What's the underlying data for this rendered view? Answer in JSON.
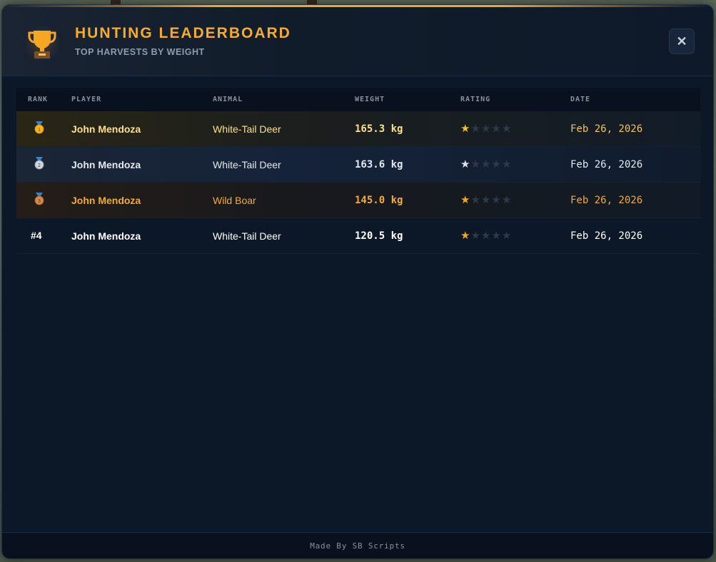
{
  "header": {
    "title": "HUNTING LEADERBOARD",
    "subtitle": "TOP HARVESTS BY WEIGHT",
    "close_label": "✕",
    "icon": "trophy-icon"
  },
  "table": {
    "columns": [
      "RANK",
      "PLAYER",
      "ANIMAL",
      "WEIGHT",
      "RATING",
      "DATE"
    ],
    "rows": [
      {
        "rank": "",
        "medal": "gold-medal-icon",
        "player": "John Mendoza",
        "animal": "White-Tail Deer",
        "weight": "165.3 kg",
        "rating": 1,
        "date": "Feb 26, 2026"
      },
      {
        "rank": "",
        "medal": "silver-medal-icon",
        "player": "John Mendoza",
        "animal": "White-Tail Deer",
        "weight": "163.6 kg",
        "rating": 1,
        "date": "Feb 26, 2026"
      },
      {
        "rank": "",
        "medal": "bronze-medal-icon",
        "player": "John Mendoza",
        "animal": "Wild Boar",
        "weight": "145.0 kg",
        "rating": 1,
        "date": "Feb 26, 2026"
      },
      {
        "rank": "#4",
        "medal": "",
        "player": "John Mendoza",
        "animal": "White-Tail Deer",
        "weight": "120.5 kg",
        "rating": 1,
        "date": "Feb 26, 2026"
      }
    ],
    "rating_max": 5
  },
  "footer": {
    "text": "Made By SB Scripts"
  },
  "colors": {
    "accent": "#f5ac2c",
    "gold_text": "#fde08a",
    "gold_date": "#f5c451",
    "silver_text": "#e4e9f0",
    "bronze_text": "#f5ac2c",
    "plain_text": "#ffffff",
    "star_gold": "#f5c02c",
    "star_silver": "#dfe4ea",
    "star_bronze": "#f5a623",
    "star_empty": "#2e3a4a"
  }
}
